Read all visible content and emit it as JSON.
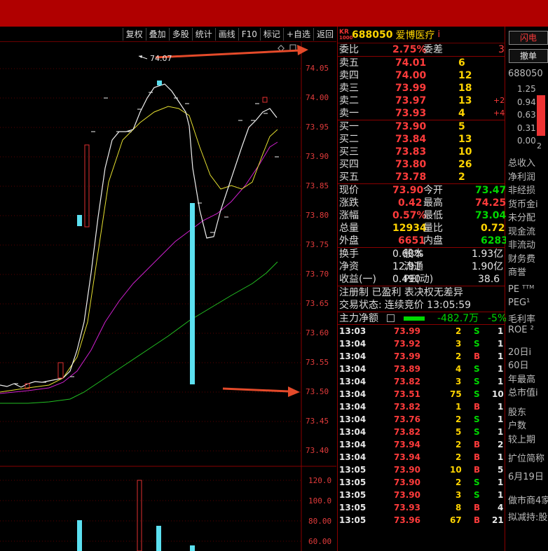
{
  "toolbar": [
    "复权",
    "叠加",
    "多股",
    "统计",
    "画线",
    "F10",
    "标记",
    "+自选",
    "返回"
  ],
  "chart": {
    "price_labels": [
      "74.05",
      "74.00",
      "73.95",
      "73.90",
      "73.85",
      "73.80",
      "73.75",
      "73.70",
      "73.65",
      "73.60",
      "73.55",
      "73.50",
      "73.45",
      "73.40"
    ],
    "high_marker": "74.07",
    "volume_labels": [
      "120.0",
      "100.0",
      "80.00",
      "60.00"
    ]
  },
  "stock": {
    "kr": "KR",
    "kr_sub": "1000",
    "code": "688050",
    "name": "爱博医疗",
    "info_mark": "i"
  },
  "weibi": {
    "label": "委比",
    "value": "2.75%",
    "label2": "委差",
    "value2": "3"
  },
  "asks": [
    {
      "label": "卖五",
      "price": "74.01",
      "vol": "6",
      "chg": ""
    },
    {
      "label": "卖四",
      "price": "74.00",
      "vol": "12",
      "chg": ""
    },
    {
      "label": "卖三",
      "price": "73.99",
      "vol": "18",
      "chg": ""
    },
    {
      "label": "卖二",
      "price": "73.97",
      "vol": "13",
      "chg": "+2"
    },
    {
      "label": "卖一",
      "price": "73.93",
      "vol": "4",
      "chg": "+4"
    }
  ],
  "bids": [
    {
      "label": "买一",
      "price": "73.90",
      "vol": "5"
    },
    {
      "label": "买二",
      "price": "73.84",
      "vol": "13"
    },
    {
      "label": "买三",
      "price": "73.83",
      "vol": "10"
    },
    {
      "label": "买四",
      "price": "73.80",
      "vol": "26"
    },
    {
      "label": "买五",
      "price": "73.78",
      "vol": "2"
    }
  ],
  "stats": [
    {
      "l1": "现价",
      "v1": "73.90",
      "c1": "red",
      "l2": "今开",
      "v2": "73.47",
      "c2": "green"
    },
    {
      "l1": "涨跌",
      "v1": "0.42",
      "c1": "red",
      "l2": "最高",
      "v2": "74.25",
      "c2": "red"
    },
    {
      "l1": "涨幅",
      "v1": "0.57%",
      "c1": "red",
      "l2": "最低",
      "v2": "73.04",
      "c2": "green"
    },
    {
      "l1": "总量",
      "v1": "12934",
      "c1": "yellow",
      "l2": "量比",
      "v2": "0.72",
      "c2": "yellow"
    },
    {
      "l1": "外盘",
      "v1": "6651",
      "c1": "red",
      "l2": "内盘",
      "v2": "6283",
      "c2": "green"
    }
  ],
  "stats2": [
    {
      "l1": "换手",
      "v1": "0.68%",
      "l2": "股本",
      "v2": "1.93亿"
    },
    {
      "l1": "净资",
      "v1": "12.91",
      "l2": "流通",
      "v2": "1.90亿"
    },
    {
      "l1": "收益(一)",
      "v1": "0.490",
      "l2": "PE(动)",
      "v2": "38.6"
    }
  ],
  "notes": {
    "reg": "注册制 已盈利 表决权无差异",
    "state_label": "交易状态:",
    "state_value": "连续竞价 13:05:59",
    "main_flow_label": "主力净额",
    "main_flow_value": "-482.7万",
    "main_flow_pct": "-5%"
  },
  "ticks": [
    {
      "t": "13:03",
      "p": "73.99",
      "v": "2",
      "d": "S",
      "n": "1"
    },
    {
      "t": "13:04",
      "p": "73.92",
      "v": "3",
      "d": "S",
      "n": "1"
    },
    {
      "t": "13:04",
      "p": "73.99",
      "v": "2",
      "d": "B",
      "n": "1"
    },
    {
      "t": "13:04",
      "p": "73.89",
      "v": "4",
      "d": "S",
      "n": "1"
    },
    {
      "t": "13:04",
      "p": "73.82",
      "v": "3",
      "d": "S",
      "n": "1"
    },
    {
      "t": "13:04",
      "p": "73.51",
      "v": "75",
      "d": "S",
      "n": "10"
    },
    {
      "t": "13:04",
      "p": "73.82",
      "v": "1",
      "d": "B",
      "n": "1"
    },
    {
      "t": "13:04",
      "p": "73.76",
      "v": "2",
      "d": "S",
      "n": "1"
    },
    {
      "t": "13:04",
      "p": "73.82",
      "v": "5",
      "d": "S",
      "n": "1"
    },
    {
      "t": "13:04",
      "p": "73.94",
      "v": "2",
      "d": "B",
      "n": "2"
    },
    {
      "t": "13:04",
      "p": "73.94",
      "v": "2",
      "d": "B",
      "n": "1"
    },
    {
      "t": "13:05",
      "p": "73.90",
      "v": "10",
      "d": "B",
      "n": "5"
    },
    {
      "t": "13:05",
      "p": "73.90",
      "v": "2",
      "d": "S",
      "n": "1"
    },
    {
      "t": "13:05",
      "p": "73.90",
      "v": "3",
      "d": "S",
      "n": "1"
    },
    {
      "t": "13:05",
      "p": "73.93",
      "v": "8",
      "d": "B",
      "n": "4"
    },
    {
      "t": "13:05",
      "p": "73.96",
      "v": "67",
      "d": "B",
      "n": "21"
    }
  ],
  "side": {
    "btn1": "闪电",
    "btn2": "撤单",
    "code": "688050",
    "scale": [
      "1.25",
      "0.94",
      "0.63",
      "0.31",
      "0.00"
    ],
    "scale_extra": "2",
    "items": [
      "总收入",
      "净利润",
      "非经损",
      "货币金i",
      "未分配",
      "现金流",
      "非流动",
      "财务费",
      "商誉"
    ],
    "items2": [
      "PE ᵀᵀᴹ",
      "PEG¹",
      "毛利率",
      "ROE ²"
    ],
    "items3": [
      "20日i",
      "60日",
      "年最高",
      "总市值i"
    ],
    "items4": [
      "股东",
      "户数",
      "较上期"
    ],
    "items5": [
      "扩位简称",
      "6月19日"
    ],
    "items6": [
      "做市商4家",
      "拟减持:股"
    ]
  }
}
